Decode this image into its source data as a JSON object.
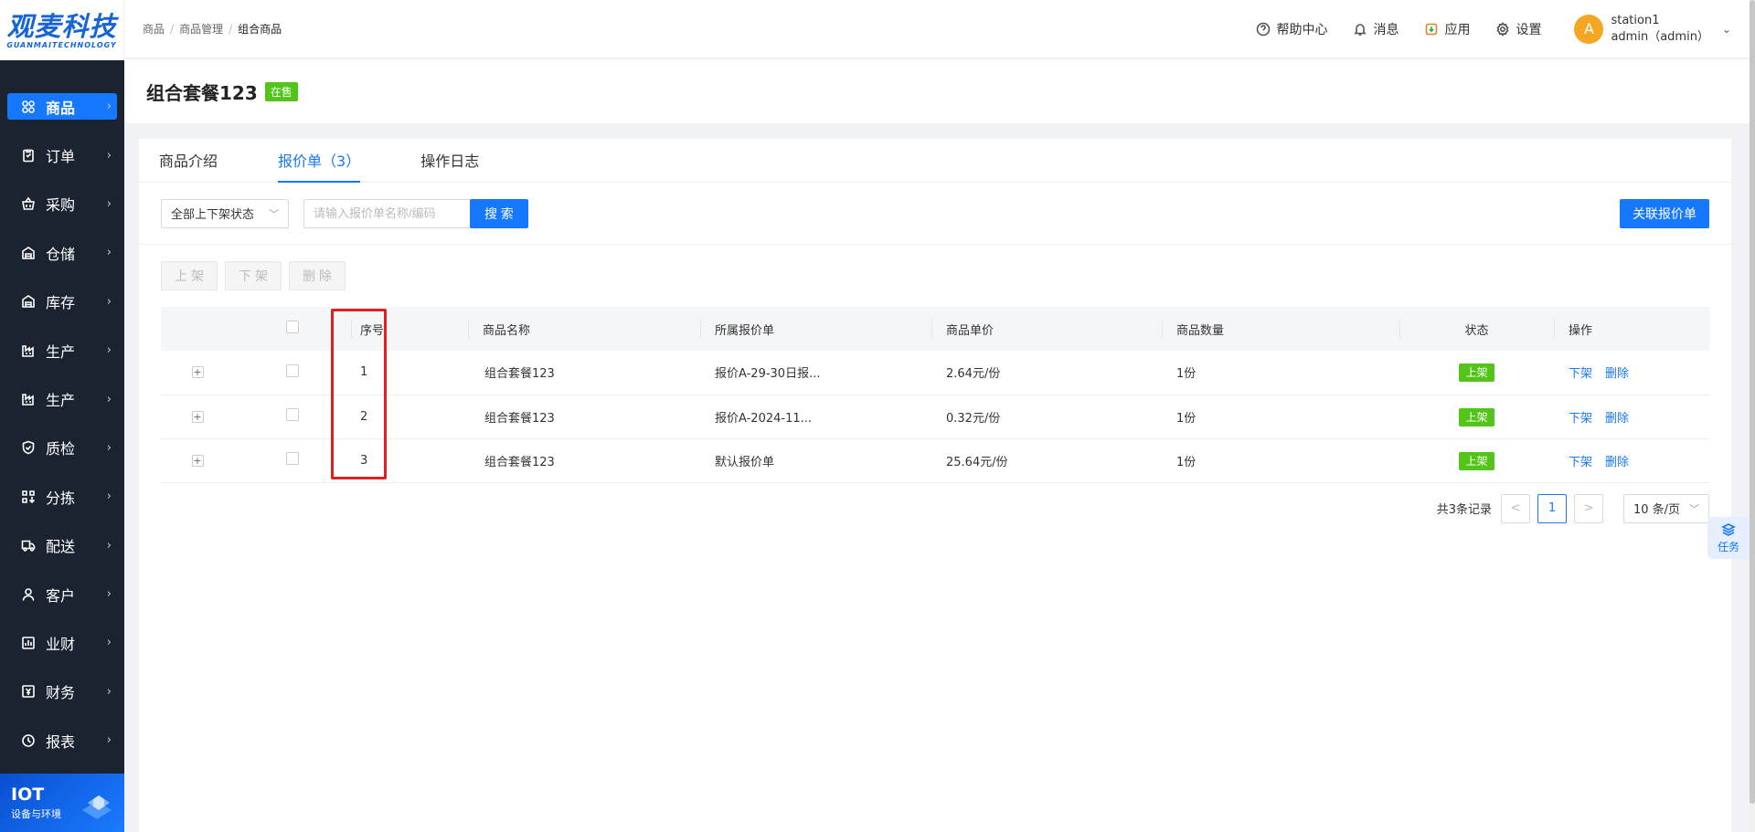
{
  "logo": {
    "main": "观麦科技",
    "sub": "GUANMAITECHNOLOGY"
  },
  "sidebar": {
    "items": [
      {
        "label": "商品",
        "icon": "grid-icon",
        "active": true
      },
      {
        "label": "订单",
        "icon": "clipboard-icon"
      },
      {
        "label": "采购",
        "icon": "basket-icon"
      },
      {
        "label": "仓储",
        "icon": "warehouse-icon"
      },
      {
        "label": "库存",
        "icon": "warehouse-icon"
      },
      {
        "label": "生产",
        "icon": "factory-icon"
      },
      {
        "label": "生产",
        "icon": "factory-icon"
      },
      {
        "label": "质检",
        "icon": "shield-icon"
      },
      {
        "label": "分拣",
        "icon": "sort-icon"
      },
      {
        "label": "配送",
        "icon": "truck-icon"
      },
      {
        "label": "客户",
        "icon": "user-icon"
      },
      {
        "label": "业财",
        "icon": "chart-icon"
      },
      {
        "label": "财务",
        "icon": "money-icon"
      },
      {
        "label": "报表",
        "icon": "clock-icon"
      }
    ]
  },
  "iot": {
    "title": "IOT",
    "subtitle": "设备与环境"
  },
  "breadcrumb": [
    "商品",
    "商品管理",
    "组合商品"
  ],
  "header": {
    "help": "帮助中心",
    "messages": "消息",
    "apps": "应用",
    "settings": "设置",
    "user": {
      "avatar": "A",
      "station": "station1",
      "name": "admin（admin）"
    }
  },
  "page": {
    "title": "组合套餐123",
    "status_badge": "在售"
  },
  "tabs": [
    {
      "label": "商品介绍"
    },
    {
      "label": "报价单（3）",
      "active": true
    },
    {
      "label": "操作日志"
    }
  ],
  "filters": {
    "status_select": "全部上下架状态",
    "search_placeholder": "请输入报价单名称/编码",
    "search_button": "搜 索",
    "link_button": "关联报价单"
  },
  "batch_actions": {
    "on_shelf": "上架",
    "off_shelf": "下架",
    "delete": "删除"
  },
  "table": {
    "headers": {
      "index": "序号",
      "name": "商品名称",
      "quote": "所属报价单",
      "price": "商品单价",
      "qty": "商品数量",
      "status": "状态",
      "ops": "操作"
    },
    "rows": [
      {
        "index": "1",
        "name": "组合套餐123",
        "quote": "报价A-29-30日报...",
        "price": "2.64元/份",
        "qty": "1份",
        "status": "上架",
        "op1": "下架",
        "op2": "删除"
      },
      {
        "index": "2",
        "name": "组合套餐123",
        "quote": "报价A-2024-11...",
        "price": "0.32元/份",
        "qty": "1份",
        "status": "上架",
        "op1": "下架",
        "op2": "删除"
      },
      {
        "index": "3",
        "name": "组合套餐123",
        "quote": "默认报价单",
        "price": "25.64元/份",
        "qty": "1份",
        "status": "上架",
        "op1": "下架",
        "op2": "删除"
      }
    ]
  },
  "pagination": {
    "total": "共3条记录",
    "prev": "<",
    "current": "1",
    "next": ">",
    "page_size": "10 条/页"
  },
  "task_float": {
    "label": "任务"
  },
  "colors": {
    "primary": "#1677ff",
    "sidebar_bg": "#1c2330",
    "status_green": "#52c41a",
    "highlight_red": "#e02020"
  }
}
